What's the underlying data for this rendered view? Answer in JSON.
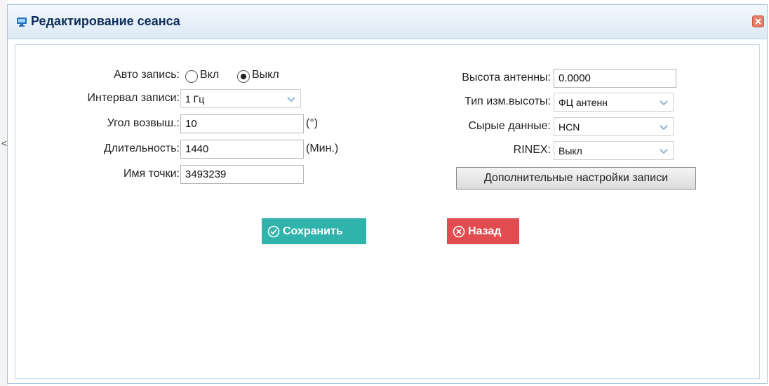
{
  "dialog": {
    "title": "Редактирование сеанса",
    "title_icon": "monitor-icon",
    "close_icon": "close-icon"
  },
  "left": {
    "auto_record": {
      "label": "Авто запись:",
      "options": [
        "Вкл",
        "Выкл"
      ],
      "selected": "Выкл"
    },
    "interval": {
      "label": "Интервал записи:",
      "value": "1 Гц"
    },
    "elevation": {
      "label": "Угол возвыш.:",
      "value": "10",
      "unit": "(°)"
    },
    "duration": {
      "label": "Длительность:",
      "value": "1440",
      "unit": "(Мин.)"
    },
    "point_name": {
      "label": "Имя точки:",
      "value": "3493239"
    }
  },
  "right": {
    "antenna_height": {
      "label": "Высота антенны:",
      "value": "0.0000"
    },
    "height_type": {
      "label": "Тип изм.высоты:",
      "value": "ФЦ антенн"
    },
    "raw_data": {
      "label": "Сырые данные:",
      "value": "HCN"
    },
    "rinex": {
      "label": "RINEX:",
      "value": "Выкл"
    },
    "advanced_button": "Дополнительные настройки записи"
  },
  "actions": {
    "save": "Сохранить",
    "back": "Назад"
  },
  "colors": {
    "save": "#2fb3aa",
    "back": "#e14c50",
    "title": "#0e2d5a"
  }
}
